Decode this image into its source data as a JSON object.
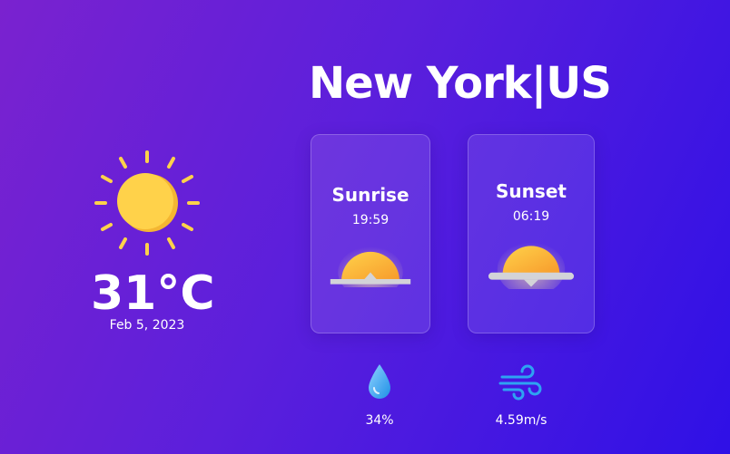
{
  "location": {
    "title": "New York|US"
  },
  "current": {
    "condition_icon": "sun-icon",
    "temperature": "31°C",
    "date": "Feb 5, 2023"
  },
  "cards": {
    "sunrise": {
      "label": "Sunrise",
      "time": "19:59",
      "icon": "sunrise-icon"
    },
    "sunset": {
      "label": "Sunset",
      "time": "06:19",
      "icon": "sunset-icon"
    }
  },
  "stats": {
    "humidity": {
      "value": "34%",
      "icon": "droplet-icon"
    },
    "wind": {
      "value": "4.59m/s",
      "icon": "wind-icon"
    }
  },
  "colors": {
    "background_start": "#7a22cf",
    "background_end": "#2f10e6",
    "sun": "#ffd24a",
    "sun_shade": "#f7a531",
    "water": "#2ea3f2"
  }
}
